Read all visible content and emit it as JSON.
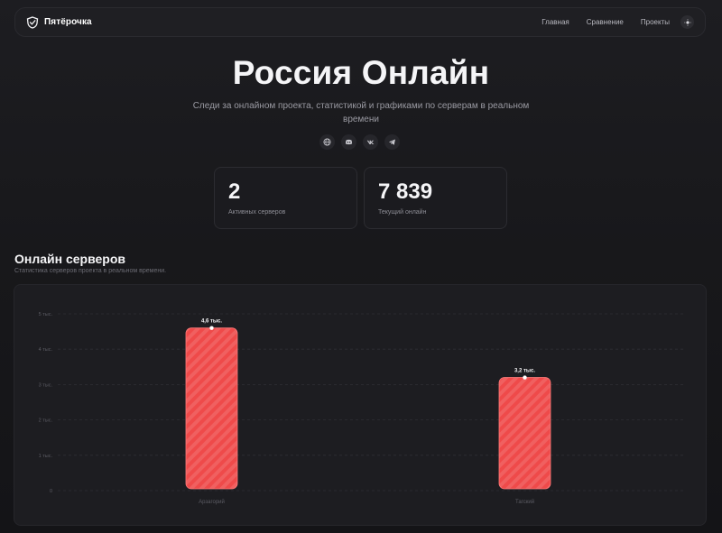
{
  "nav": {
    "brand": "Пятёрочка",
    "links": [
      "Главная",
      "Сравнение",
      "Проекты"
    ]
  },
  "hero": {
    "title": "Россия Онлайн",
    "subtitle": "Следи за онлайном проекта, статистикой и графиками по серверам в реальном времени",
    "socials": [
      "globe-icon",
      "discord-icon",
      "vk-icon",
      "telegram-icon"
    ]
  },
  "stats": [
    {
      "value": "2",
      "label": "Активных серверов"
    },
    {
      "value": "7 839",
      "label": "Текущий онлайн"
    }
  ],
  "section": {
    "title": "Онлайн серверов",
    "subtitle": "Статистика серверов проекта в реальном времени."
  },
  "chart_data": {
    "type": "bar",
    "categories": [
      "Арзагорий",
      "Тагский"
    ],
    "values": [
      4600,
      3200
    ],
    "data_labels": [
      "4,6 тыс.",
      "3,2 тыс."
    ],
    "yticks": [
      0,
      1000,
      2000,
      3000,
      4000,
      5000
    ],
    "ytick_labels": [
      "0",
      "1 тыс.",
      "2 тыс.",
      "3 тыс.",
      "4 тыс.",
      "5 тыс."
    ],
    "ylim": [
      0,
      5000
    ],
    "grid": true,
    "bar_color": "#ef4a4a"
  }
}
